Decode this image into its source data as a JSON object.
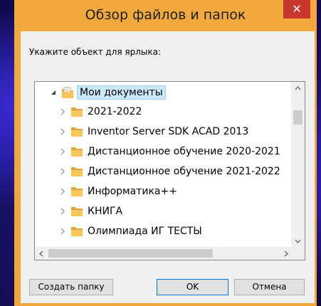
{
  "dialog": {
    "title": "Обзор файлов и папок",
    "close_glyph": "✕",
    "prompt": "Укажите объект для ярлыка:"
  },
  "tree": {
    "root": {
      "label": "Мои документы",
      "expanded": true,
      "selected": true
    },
    "items": [
      {
        "label": "2021-2022"
      },
      {
        "label": "Inventor Server SDK ACAD 2013"
      },
      {
        "label": "Дистанционное обучение 2020-2021"
      },
      {
        "label": "Дистанционное обучение 2021-2022"
      },
      {
        "label": "Информатика++"
      },
      {
        "label": "КНИГА"
      },
      {
        "label": "Олимпиада ИГ ТЕСТЫ"
      }
    ]
  },
  "buttons": {
    "new_folder": "Создать папку",
    "ok": "OK",
    "cancel": "Отмена"
  },
  "colors": {
    "titlebar": "#f3a93c",
    "close": "#c7362d",
    "selection": "#cce8ff",
    "default_button_border": "#0078d7"
  }
}
